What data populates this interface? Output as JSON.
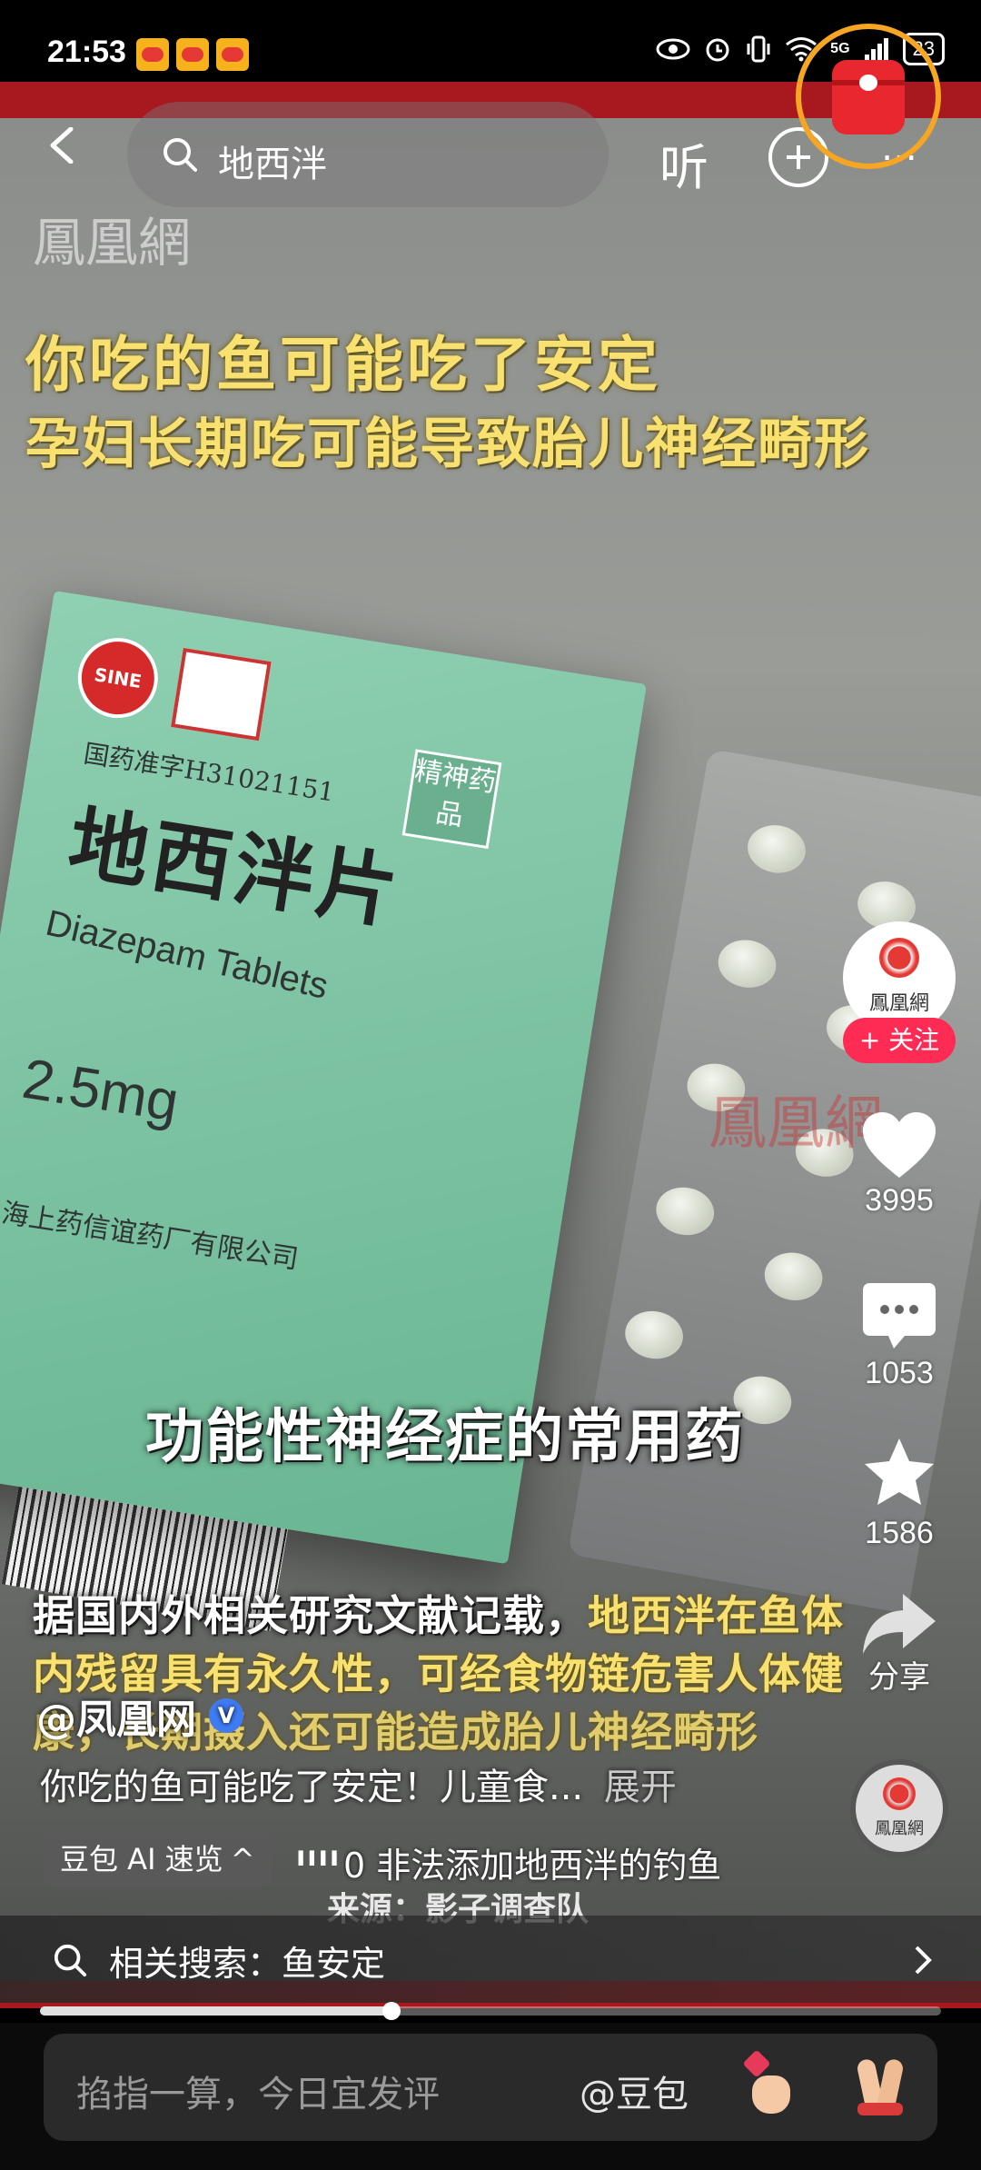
{
  "status_bar": {
    "time": "21:53",
    "signal_label": "5G",
    "battery": "23"
  },
  "top_nav": {
    "search_query": "地西泮",
    "listen_label": "听"
  },
  "video": {
    "watermark": "鳳凰網",
    "headline_line1": "你吃的鱼可能吃了安定",
    "headline_line2": "孕妇长期吃可能导致胎儿神经畸形",
    "box": {
      "approval": "国药准字H31021151",
      "name_cn": "地西泮片",
      "name_en": "Diazepam Tablets",
      "dose": "2.5mg",
      "maker": "上海上药信谊药厂有限公司",
      "badge": "精神药品",
      "brand": "SINE"
    },
    "middle_caption": "功能性神经症的常用药",
    "bottom_caption_white": "据国内外相关研究文献记载，",
    "bottom_caption_yellow1": "地西泮在鱼体",
    "bottom_caption_yellow2": "内残留具有永久性，可经食物链危害人体健",
    "bottom_caption_yellow3": "康，长期摄入还可能造成胎儿神经畸形",
    "source_line": "来源：影子调查队"
  },
  "right_rail": {
    "avatar_label": "鳳凰網",
    "follow": "+ 关注",
    "likes": "3995",
    "comments": "1053",
    "favorites": "1586",
    "share": "分享"
  },
  "post": {
    "author": "@凤凰网",
    "title": "你吃的鱼可能吃了安定！儿童食...",
    "expand": "展开",
    "ai_chip": "豆包 AI 速览",
    "ai_scroll_text": "0 非法添加地西泮的钓鱼"
  },
  "related_search": {
    "label": "相关搜索：鱼安定"
  },
  "progress": {
    "value": 0.39
  },
  "comment_bar": {
    "placeholder": "掐指一算，今日宜发评",
    "mention": "@豆包"
  },
  "colors": {
    "accent_red": "#fe2c55",
    "caption_yellow": "#f8e071",
    "brand_red": "#a8191f"
  }
}
